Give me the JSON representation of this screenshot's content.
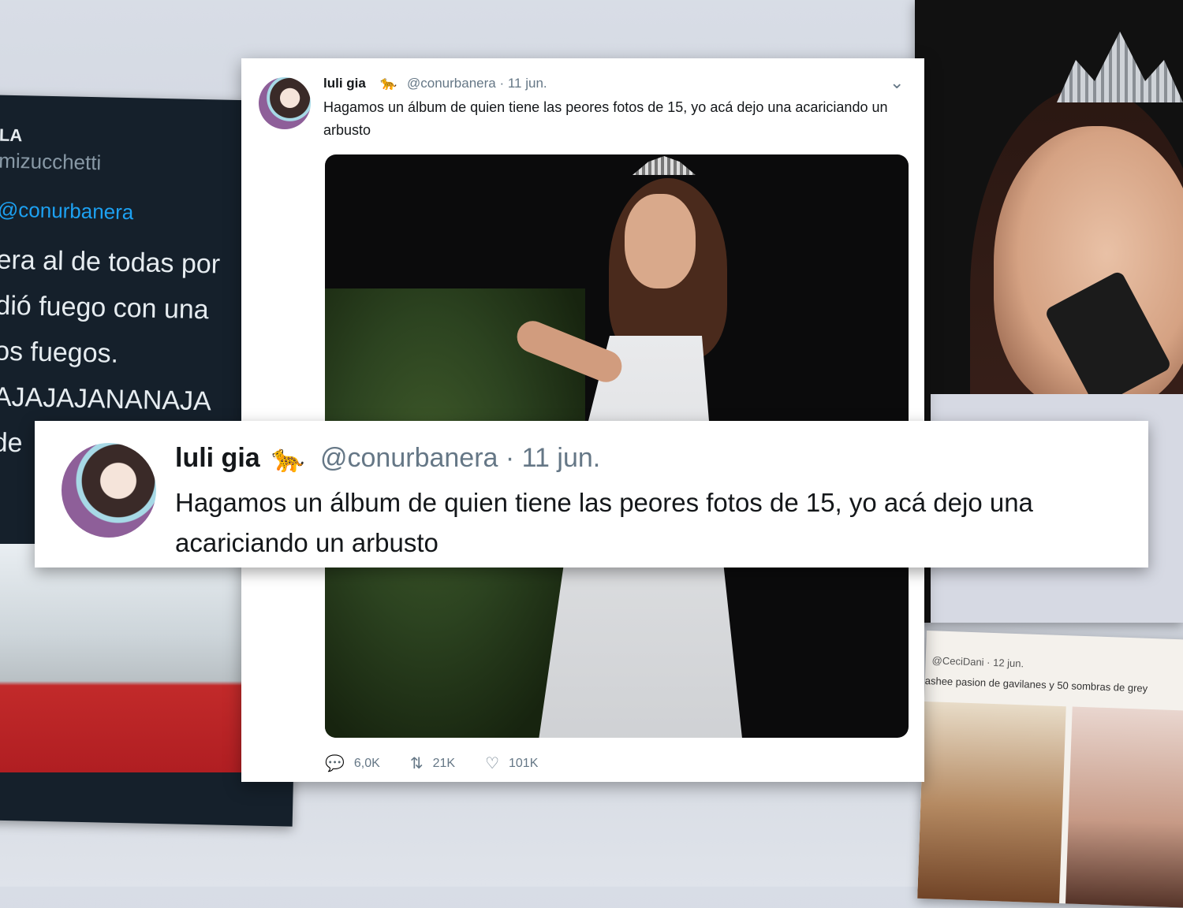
{
  "left_tweet": {
    "name_fragment": "LA",
    "handle_fragment": "mizucchetti",
    "reply_to": "@conurbanera",
    "lines": [
      "era al de todas por",
      "dió fuego con una",
      "os fuegos.",
      "AJAJAJANANAJA",
      "de"
    ]
  },
  "bottom_right_tweet": {
    "handle": "@CeciDani · 12 jun.",
    "text": "ashee pasion de gavilanes y 50 sombras de grey"
  },
  "main_tweet": {
    "name": "luli gia",
    "emoji": "🐆",
    "handle": "@conurbanera",
    "date": "· 11 jun.",
    "text": "Hagamos un álbum de quien tiene las peores fotos de 15, yo acá dejo una acariciando un arbusto",
    "replies": "6,0K",
    "retweets": "21K",
    "likes": "101K"
  },
  "banner": {
    "name": "luli gia",
    "emoji": "🐆",
    "handle": "@conurbanera · 11 jun.",
    "text": "Hagamos un álbum de quien tiene las peores fotos de 15, yo acá dejo una acariciando un arbusto"
  },
  "colors": {
    "twitter_blue": "#1da1f2",
    "dark_bg": "#15202b",
    "secondary": "#657786"
  }
}
